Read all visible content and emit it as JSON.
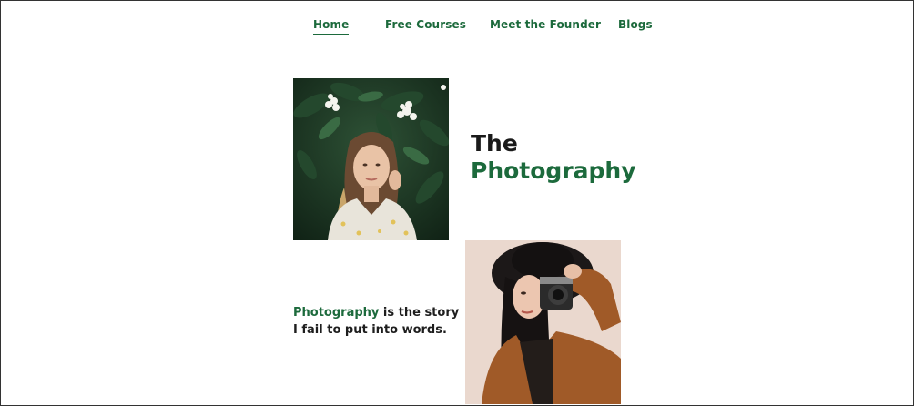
{
  "nav": {
    "items": [
      {
        "label": "Home",
        "active": true
      },
      {
        "label": "Free Courses",
        "active": false
      },
      {
        "label": "Meet the Founder",
        "active": false
      },
      {
        "label": "Blogs",
        "active": false
      }
    ]
  },
  "hero": {
    "title_line1": "The",
    "title_line2": "Photography"
  },
  "quote": {
    "accent_word": "Photography",
    "line1_rest": " is the story",
    "line2": "I fail to put into words."
  },
  "colors": {
    "accent": "#1c6a3c",
    "text": "#1e1e1e",
    "background": "#ffffff"
  }
}
